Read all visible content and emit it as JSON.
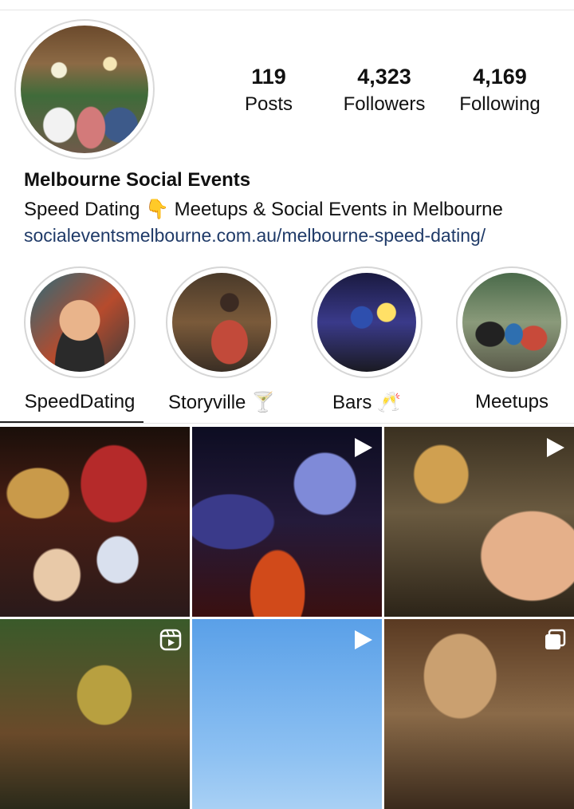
{
  "profile": {
    "stats": {
      "posts": {
        "value": "119",
        "label": "Posts"
      },
      "followers": {
        "value": "4,323",
        "label": "Followers"
      },
      "following": {
        "value": "4,169",
        "label": "Following"
      }
    },
    "name": "Melbourne Social Events",
    "bio": "Speed Dating 👇 Meetups & Social Events in Melbourne",
    "link": "socialeventsmelbourne.com.au/melbourne-speed-dating/"
  },
  "highlights": [
    {
      "label": "SpeedDating"
    },
    {
      "label": "Storyville 🍸"
    },
    {
      "label": "Bars 🥂"
    },
    {
      "label": "Meetups"
    }
  ],
  "grid": {
    "tiles": [
      {
        "type": "photo"
      },
      {
        "type": "video",
        "icon": "play-icon"
      },
      {
        "type": "video",
        "icon": "play-icon"
      },
      {
        "type": "reel",
        "icon": "reel-icon"
      },
      {
        "type": "video",
        "icon": "play-icon"
      },
      {
        "type": "carousel",
        "icon": "carousel-icon"
      }
    ]
  },
  "colors": {
    "link": "#1f3a68",
    "ring": "#d6d6d6",
    "text": "#111111"
  }
}
